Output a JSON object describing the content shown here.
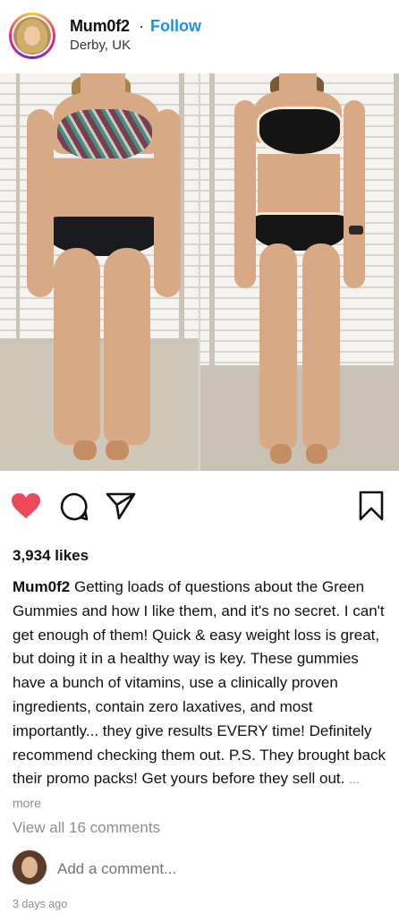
{
  "header": {
    "username": "Mum0f2",
    "separator": "·",
    "follow_label": "Follow",
    "location": "Derby, UK"
  },
  "actions": {
    "liked": true,
    "like_color": "#ed4956",
    "icons": [
      "heart-icon",
      "comment-icon",
      "share-icon",
      "bookmark-icon"
    ]
  },
  "post": {
    "likes": "3,934 likes",
    "caption_user": "Mum0f2",
    "caption_text": "Getting loads of questions about the Green Gummies and how I like them, and it's no secret. I can't get enough of them! Quick & easy weight loss is great, but doing it in a healthy way is key. These gummies have a bunch of vitamins, use a clinically proven ingredients, contain zero laxatives, and most importantly... they give results EVERY time! Definitely recommend checking them out. P.S. They brought back their promo packs! Get yours before they sell out.",
    "more_label": "... more",
    "view_comments": "View all 16 comments",
    "add_comment_placeholder": "Add a comment...",
    "timestamp": "3 days ago"
  },
  "colors": {
    "accent": "#1a91f0",
    "muted": "#8e8e8e"
  }
}
